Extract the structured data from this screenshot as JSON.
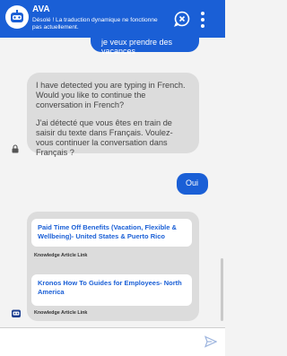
{
  "header": {
    "title": "AVA",
    "subtitle": "Désolé ! La traduction dynamique ne fonctionne pas actuellement."
  },
  "messages": {
    "user1": "je veux prendre des vacances",
    "bot1_p1": "I have detected you are typing in French. Would you like to continue the conversation in French?",
    "bot1_p2": "J'ai détecté que vous êtes en train de saisir du texte dans Français. Voulez-vous continuer la conversation dans Français ?",
    "user2": "Oui"
  },
  "articles": [
    {
      "title": "Paid Time Off Benefits (Vacation, Flexible & Wellbeing)- United States & Puerto Rico",
      "meta": "Knowledge Article Link"
    },
    {
      "title": "Kronos How To Guides for Employees- North America",
      "meta": "Knowledge Article Link"
    }
  ],
  "footer": {
    "input_value": "",
    "input_placeholder": ""
  },
  "icons": {
    "avatar": "robot-icon",
    "close": "close-chat-icon",
    "menu": "more-vertical-icon",
    "lock": "lock-icon",
    "bot": "bot-icon",
    "send": "send-icon"
  },
  "colors": {
    "brand": "#1a5fd6",
    "bubble": "#dcdcdc",
    "background": "#f3f3f3"
  }
}
